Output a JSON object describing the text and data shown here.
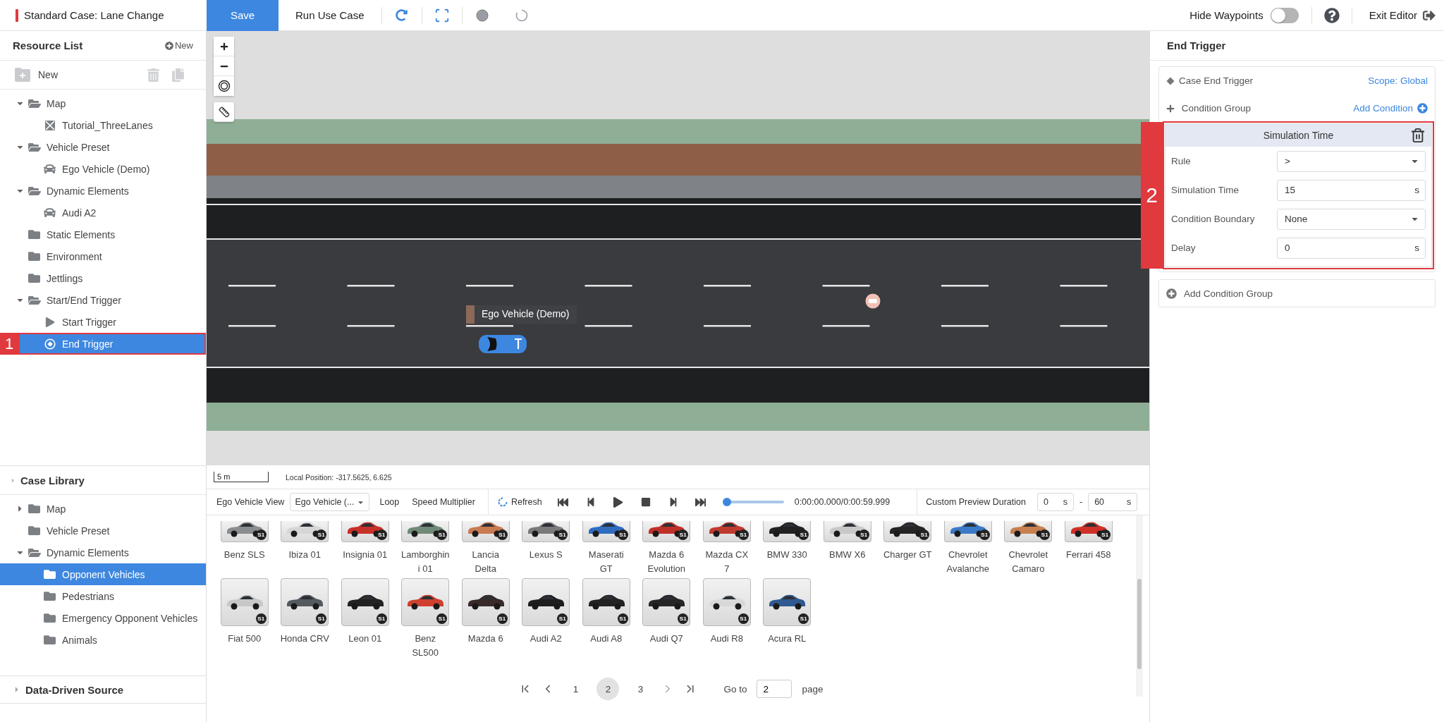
{
  "header": {
    "title": "Standard Case: Lane Change",
    "save": "Save",
    "run": "Run Use Case",
    "hide_waypoints": {
      "label": "Hide Waypoints",
      "on": false
    },
    "exit": "Exit Editor"
  },
  "resource_list": {
    "title": "Resource List",
    "new_link": "New",
    "new_button": "New",
    "tree": [
      {
        "label": "Map",
        "kind": "folder",
        "expanded": true,
        "selected": false,
        "children": [
          {
            "label": "Tutorial_ThreeLanes",
            "kind": "map",
            "selected": false
          }
        ]
      },
      {
        "label": "Vehicle Preset",
        "kind": "folder",
        "expanded": true,
        "selected": false,
        "children": [
          {
            "label": "Ego Vehicle (Demo)",
            "kind": "vehicle",
            "selected": false
          }
        ]
      },
      {
        "label": "Dynamic Elements",
        "kind": "folder",
        "expanded": true,
        "selected": false,
        "children": [
          {
            "label": "Audi A2",
            "kind": "vehicle",
            "selected": false
          }
        ]
      },
      {
        "label": "Static Elements",
        "kind": "folder",
        "selected": false
      },
      {
        "label": "Environment",
        "kind": "folder",
        "selected": false
      },
      {
        "label": "Jettlings",
        "kind": "folder",
        "selected": false
      },
      {
        "label": "Start/End Trigger",
        "kind": "folder",
        "expanded": true,
        "selected": false,
        "children": [
          {
            "label": "Start Trigger",
            "kind": "start",
            "selected": false
          },
          {
            "label": "End Trigger",
            "kind": "end",
            "selected": true,
            "annotation": "1"
          }
        ]
      }
    ]
  },
  "case_library": {
    "title": "Case Library",
    "tree": [
      {
        "label": "Map",
        "kind": "folder",
        "expanded": false,
        "selected": false
      },
      {
        "label": "Vehicle Preset",
        "kind": "folder",
        "selected": false
      },
      {
        "label": "Dynamic Elements",
        "kind": "folder",
        "expanded": true,
        "selected": false,
        "children": [
          {
            "label": "Opponent Vehicles",
            "kind": "folder",
            "selected": true
          },
          {
            "label": "Pedestrians",
            "kind": "folder",
            "selected": false
          },
          {
            "label": "Emergency Opponent Vehicles",
            "kind": "folder",
            "selected": false
          },
          {
            "label": "Animals",
            "kind": "folder",
            "selected": false
          }
        ]
      }
    ]
  },
  "data_source": {
    "title": "Data-Driven Source"
  },
  "map": {
    "ego_label": "Ego Vehicle (Demo)",
    "scale": "5 m",
    "local_position": "Local Position: -317.5625, 6.625"
  },
  "playback": {
    "view_label": "Ego Vehicle View",
    "view_select": "Ego Vehicle (...",
    "loop": "Loop",
    "speed": "Speed Multiplier",
    "refresh": "Refresh",
    "progress": {
      "level": 0
    },
    "time": "0:00:00.000/0:00:59.999",
    "duration_label": "Custom Preview Duration",
    "start": {
      "value": "0",
      "unit": "s"
    },
    "separator": "-",
    "end": {
      "value": "60",
      "unit": "s"
    }
  },
  "vehicles": [
    {
      "name": "Benz SLS",
      "badge": "S1",
      "color": "#8a8d90"
    },
    {
      "name": "Ibiza 01",
      "badge": "S1",
      "color": "#d6d6d6"
    },
    {
      "name": "Insignia 01",
      "badge": "S1",
      "color": "#c8302a"
    },
    {
      "name": "Lamborghini 01",
      "badge": "S1",
      "color": "#6f8a78"
    },
    {
      "name": "Lancia Delta",
      "badge": "S1",
      "color": "#c87a50"
    },
    {
      "name": "Lexus S",
      "badge": "S1",
      "color": "#7a7a7a"
    },
    {
      "name": "Maserati GT",
      "badge": "S1",
      "color": "#2f6cc0"
    },
    {
      "name": "Mazda 6 Evolution",
      "badge": "S1",
      "color": "#c0302a"
    },
    {
      "name": "Mazda CX 7",
      "badge": "S1",
      "color": "#c03a30"
    },
    {
      "name": "BMW 330",
      "badge": "S1",
      "color": "#222222"
    },
    {
      "name": "BMW X6",
      "badge": "S1",
      "color": "#c8c8c8"
    },
    {
      "name": "Charger GT",
      "badge": "S1",
      "color": "#252525"
    },
    {
      "name": "Chevrolet Avalanche",
      "badge": "S1",
      "color": "#3a7ac8"
    },
    {
      "name": "Chevrolet Camaro",
      "badge": "S1",
      "color": "#c88050"
    },
    {
      "name": "Ferrari 458",
      "badge": "S1",
      "color": "#d03028"
    },
    {
      "name": "Fiat 500",
      "badge": "S1",
      "color": "#c8c8c8"
    },
    {
      "name": "Honda CRV",
      "badge": "S1",
      "color": "#555a60"
    },
    {
      "name": "Leon 01",
      "badge": "S1",
      "color": "#222222"
    },
    {
      "name": "Benz SL500",
      "badge": "S1",
      "color": "#d04030"
    },
    {
      "name": "Mazda 6",
      "badge": "S1",
      "color": "#3a2a2a"
    },
    {
      "name": "Audi A2",
      "badge": "S1",
      "color": "#1e1e1e"
    },
    {
      "name": "Audi A8",
      "badge": "S1",
      "color": "#232323"
    },
    {
      "name": "Audi Q7",
      "badge": "S1",
      "color": "#262626"
    },
    {
      "name": "Audi R8",
      "badge": "S1",
      "color": "#d8d8d8"
    },
    {
      "name": "Acura RL",
      "badge": "S1",
      "color": "#2f5a90"
    }
  ],
  "pagination": {
    "pages": [
      {
        "label": "1",
        "selected": false
      },
      {
        "label": "2",
        "selected": true
      },
      {
        "label": "3",
        "selected": false
      }
    ],
    "goto_label": "Go to",
    "goto_value": "2",
    "page_label": "page"
  },
  "end_trigger": {
    "title": "End Trigger",
    "case_label": "Case End Trigger",
    "scope": "Scope: Global",
    "group_label": "Condition Group",
    "add_condition": "Add Condition",
    "condition": {
      "title": "Simulation Time",
      "annotation": "2",
      "fields": [
        {
          "kind": "select",
          "label": "Rule",
          "value": ">"
        },
        {
          "kind": "number",
          "label": "Simulation Time",
          "value": "15",
          "unit": "s"
        },
        {
          "kind": "select",
          "label": "Condition Boundary",
          "value": "None"
        },
        {
          "kind": "number",
          "label": "Delay",
          "value": "0",
          "unit": "s"
        }
      ]
    },
    "add_group": "Add Condition Group"
  }
}
